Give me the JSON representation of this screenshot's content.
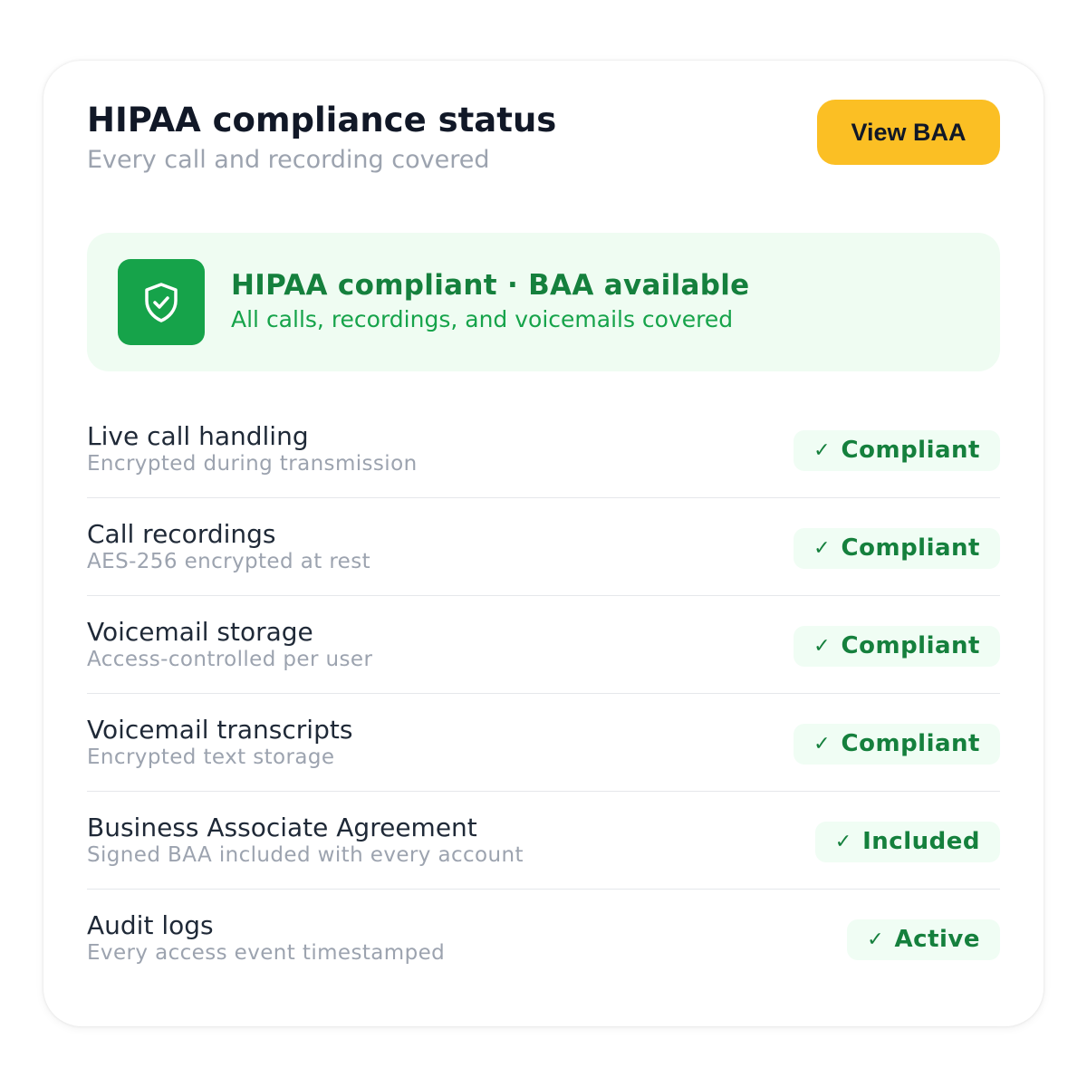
{
  "header": {
    "title": "HIPAA compliance status",
    "subtitle": "Every call and recording covered",
    "button_label": "View BAA"
  },
  "banner": {
    "icon": "shield-check-icon",
    "title": "HIPAA compliant · BAA available",
    "subtitle": "All calls, recordings, and voicemails covered"
  },
  "items": [
    {
      "title": "Live call handling",
      "description": "Encrypted during transmission",
      "status": "Compliant"
    },
    {
      "title": "Call recordings",
      "description": "AES-256 encrypted at rest",
      "status": "Compliant"
    },
    {
      "title": "Voicemail storage",
      "description": "Access-controlled per user",
      "status": "Compliant"
    },
    {
      "title": "Voicemail transcripts",
      "description": "Encrypted text storage",
      "status": "Compliant"
    },
    {
      "title": "Business Associate Agreement",
      "description": "Signed BAA included with every account",
      "status": "Included"
    },
    {
      "title": "Audit logs",
      "description": "Every access event timestamped",
      "status": "Active"
    }
  ],
  "status_check_glyph": "✓",
  "colors": {
    "accent_button": "#fbbf24",
    "success_dark": "#15803d",
    "success": "#16a34a",
    "success_bg": "#effcf2"
  }
}
